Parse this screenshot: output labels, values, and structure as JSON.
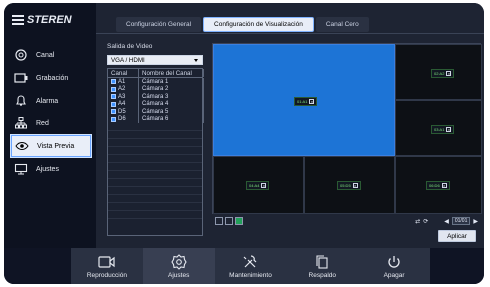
{
  "brand": {
    "name": "STEREN"
  },
  "sidebar": {
    "items": [
      {
        "label": "Canal",
        "icon": "camera-icon"
      },
      {
        "label": "Grabación",
        "icon": "record-icon"
      },
      {
        "label": "Alarma",
        "icon": "alarm-icon"
      },
      {
        "label": "Red",
        "icon": "network-icon"
      },
      {
        "label": "Vista Previa",
        "icon": "eye-icon"
      },
      {
        "label": "Ajustes",
        "icon": "display-icon"
      }
    ]
  },
  "tabs": [
    "Configuración General",
    "Configuración de Visualización",
    "Canal Cero"
  ],
  "video_output": {
    "label": "Salida de Video",
    "value": "VGA / HDMI"
  },
  "channel_table": {
    "headers": [
      "Canal",
      "Nombre del Canal"
    ],
    "rows": [
      {
        "channel": "A1",
        "name": "Cámara 1"
      },
      {
        "channel": "A2",
        "name": "Cámara 2"
      },
      {
        "channel": "A3",
        "name": "Cámara 3"
      },
      {
        "channel": "A4",
        "name": "Cámara 4"
      },
      {
        "channel": "D5",
        "name": "Cámara 5"
      },
      {
        "channel": "D6",
        "name": "Cámara 6"
      }
    ]
  },
  "preview": {
    "cells": [
      {
        "label": "01:A1"
      },
      {
        "label": "02:A2"
      },
      {
        "label": "03:A1"
      },
      {
        "label": "04:A4"
      },
      {
        "label": "05:D5"
      },
      {
        "label": "06:D6"
      }
    ],
    "page": "01/01"
  },
  "apply_label": "Aplicar",
  "bottom_bar": {
    "items": [
      {
        "label": "Reproducción",
        "icon": "video-camera-icon"
      },
      {
        "label": "Ajustes",
        "icon": "settings-icon"
      },
      {
        "label": "Mantenimiento",
        "icon": "tools-icon"
      },
      {
        "label": "Respaldo",
        "icon": "copy-icon"
      },
      {
        "label": "Apagar",
        "icon": "power-icon"
      }
    ]
  },
  "colors": {
    "accent": "#1d74d6",
    "bg": "#1e2433",
    "sidebar": "#0d1220"
  }
}
